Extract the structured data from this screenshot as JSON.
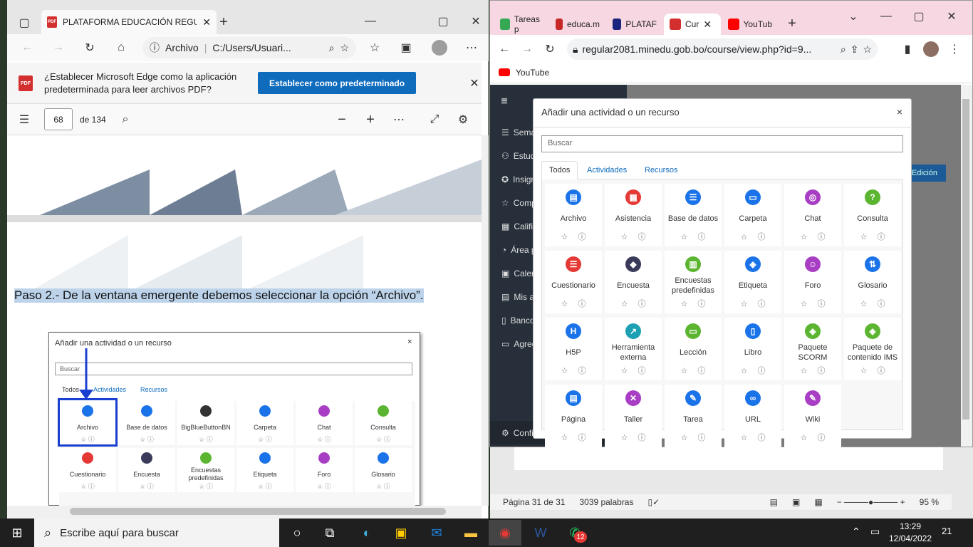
{
  "edge": {
    "tab_title": "PLATAFORMA EDUCACIÓN REGU",
    "addr_label": "Archivo",
    "addr_path": "C:/Users/Usuari...",
    "notice_text": "¿Establecer Microsoft Edge como la aplicación predeterminada para leer archivos PDF?",
    "notice_button": "Establecer como predeterminado",
    "page_current": "68",
    "page_total": "de 134",
    "doc_text": "Paso 2.- De la ventana emergente debemos seleccionar la opción “Archivo”.",
    "shot": {
      "title": "Añadir una actividad o un recurso",
      "search_placeholder": "Buscar",
      "tabs": [
        "Todos",
        "Actividades",
        "Recursos"
      ],
      "modules": [
        {
          "name": "Archivo",
          "color": "#1a73e8",
          "icon": "file-icon"
        },
        {
          "name": "Base de datos",
          "color": "#1a73e8",
          "icon": "database-icon"
        },
        {
          "name": "BigBlueButtonBN",
          "color": "#333333",
          "icon": "bigbluebutton-icon"
        },
        {
          "name": "Carpeta",
          "color": "#1a73e8",
          "icon": "folder-icon"
        },
        {
          "name": "Chat",
          "color": "#a83ec4",
          "icon": "chat-icon"
        },
        {
          "name": "Consulta",
          "color": "#5cb531",
          "icon": "choice-icon"
        },
        {
          "name": "Cuestionario",
          "color": "#e53935",
          "icon": "quiz-icon"
        },
        {
          "name": "Encuesta",
          "color": "#3a3a5a",
          "icon": "survey-icon"
        },
        {
          "name": "Encuestas predefinidas",
          "color": "#5cb531",
          "icon": "chart-icon"
        },
        {
          "name": "Etiqueta",
          "color": "#1a73e8",
          "icon": "label-icon"
        },
        {
          "name": "Foro",
          "color": "#a83ec4",
          "icon": "forum-icon"
        },
        {
          "name": "Glosario",
          "color": "#1a73e8",
          "icon": "glossary-icon"
        }
      ]
    }
  },
  "chrome": {
    "tabs": [
      {
        "title": "Tareas p",
        "color": "#34a853"
      },
      {
        "title": "educa.m",
        "color": "#c62828"
      },
      {
        "title": "PLATAF",
        "color": "#1a237e"
      },
      {
        "title": "Cur",
        "color": "#d32f2f"
      },
      {
        "title": "YouTub",
        "color": "#ff0000"
      }
    ],
    "url": "regular2081.minedu.gob.bo/course/view.php?id=9...",
    "bookmark": "YouTube",
    "sidebar": [
      "Sema",
      "Estudi",
      "Insign",
      "Comp",
      "Califi",
      "Área p",
      "Calen",
      "Mis ar",
      "Banco",
      "Agreg"
    ],
    "sidebar_bottom": "Configu",
    "edit_button": "Edición"
  },
  "modal": {
    "title": "Añadir una actividad o un recurso",
    "close": "×",
    "search_placeholder": "Buscar",
    "tabs": [
      "Todos",
      "Actividades",
      "Recursos"
    ],
    "modules": [
      {
        "name": "Archivo",
        "color": "#1a73e8",
        "glyph": "▤",
        "icon": "file-icon"
      },
      {
        "name": "Asistencia",
        "color": "#e53935",
        "glyph": "▦",
        "icon": "attendance-icon"
      },
      {
        "name": "Base de datos",
        "color": "#1a73e8",
        "glyph": "☰",
        "icon": "database-icon"
      },
      {
        "name": "Carpeta",
        "color": "#1a73e8",
        "glyph": "▭",
        "icon": "folder-icon"
      },
      {
        "name": "Chat",
        "color": "#a83ec4",
        "glyph": "◎",
        "icon": "chat-icon"
      },
      {
        "name": "Consulta",
        "color": "#5cb531",
        "glyph": "?",
        "icon": "choice-icon"
      },
      {
        "name": "Cuestionario",
        "color": "#e53935",
        "glyph": "☰",
        "icon": "quiz-icon"
      },
      {
        "name": "Encuesta",
        "color": "#3a3a5a",
        "glyph": "◆",
        "icon": "survey-icon"
      },
      {
        "name": "Encuestas predefinidas",
        "color": "#5cb531",
        "glyph": "▥",
        "icon": "chart-icon"
      },
      {
        "name": "Etiqueta",
        "color": "#1a73e8",
        "glyph": "◈",
        "icon": "label-icon"
      },
      {
        "name": "Foro",
        "color": "#a83ec4",
        "glyph": "☺",
        "icon": "forum-icon"
      },
      {
        "name": "Glosario",
        "color": "#1a73e8",
        "glyph": "⇅",
        "icon": "glossary-icon"
      },
      {
        "name": "H5P",
        "color": "#1a73e8",
        "glyph": "H",
        "icon": "h5p-icon"
      },
      {
        "name": "Herramienta externa",
        "color": "#1ea0b4",
        "glyph": "↗",
        "icon": "external-tool-icon"
      },
      {
        "name": "Lección",
        "color": "#5cb531",
        "glyph": "▭",
        "icon": "lesson-icon"
      },
      {
        "name": "Libro",
        "color": "#1a73e8",
        "glyph": "▯",
        "icon": "book-icon"
      },
      {
        "name": "Paquete SCORM",
        "color": "#5cb531",
        "glyph": "◈",
        "icon": "scorm-icon"
      },
      {
        "name": "Paquete de contenido IMS",
        "color": "#5cb531",
        "glyph": "◈",
        "icon": "ims-icon"
      },
      {
        "name": "Página",
        "color": "#1a73e8",
        "glyph": "▤",
        "icon": "page-icon"
      },
      {
        "name": "Taller",
        "color": "#a83ec4",
        "glyph": "✕",
        "icon": "workshop-icon"
      },
      {
        "name": "Tarea",
        "color": "#1a73e8",
        "glyph": "✎",
        "icon": "assignment-icon"
      },
      {
        "name": "URL",
        "color": "#1a73e8",
        "glyph": "∞",
        "icon": "url-icon"
      },
      {
        "name": "Wiki",
        "color": "#a83ec4",
        "glyph": "✎",
        "icon": "wiki-icon"
      }
    ]
  },
  "word": {
    "page_info": "Página 31 de 31",
    "words": "3039 palabras",
    "zoom": "95 %"
  },
  "taskbar": {
    "search_placeholder": "Escribe aquí para buscar",
    "time": "13:29",
    "date": "12/04/2022",
    "whatsapp_badge": "12",
    "notifications": "21"
  }
}
